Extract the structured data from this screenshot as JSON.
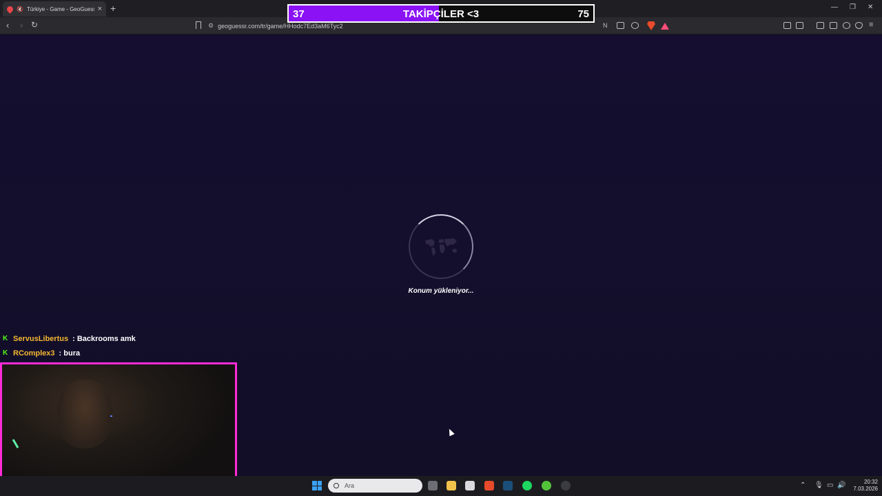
{
  "browser": {
    "tab_title": "Türkiye - Game - GeoGuessr",
    "tab_audio_icon": "speaker-muted-icon",
    "new_tab_label": "+",
    "url": "geoguessr.com/tr/game/HHodc7Ed3aM6Tyc2"
  },
  "goal_overlay": {
    "current": "37",
    "label": "TAKİPÇİLER <3",
    "target": "75",
    "progress": 0.4933,
    "fill_color": "#8a12f5"
  },
  "page": {
    "loading_text": "Konum yükleniyor...",
    "background_color": "#140f2c"
  },
  "chat": [
    {
      "user": "ServusLibertus",
      "message": ": Backrooms amk"
    },
    {
      "user": "RComplex3",
      "message": ": bura"
    }
  ],
  "webcam": {
    "border_color": "#ff2bd6"
  },
  "taskbar": {
    "search_placeholder": "Ara",
    "time": "20:32",
    "date": "7.03.2026"
  },
  "colors": {
    "accent_chat_user": "#f5b731",
    "kick_green": "#53fc18"
  }
}
